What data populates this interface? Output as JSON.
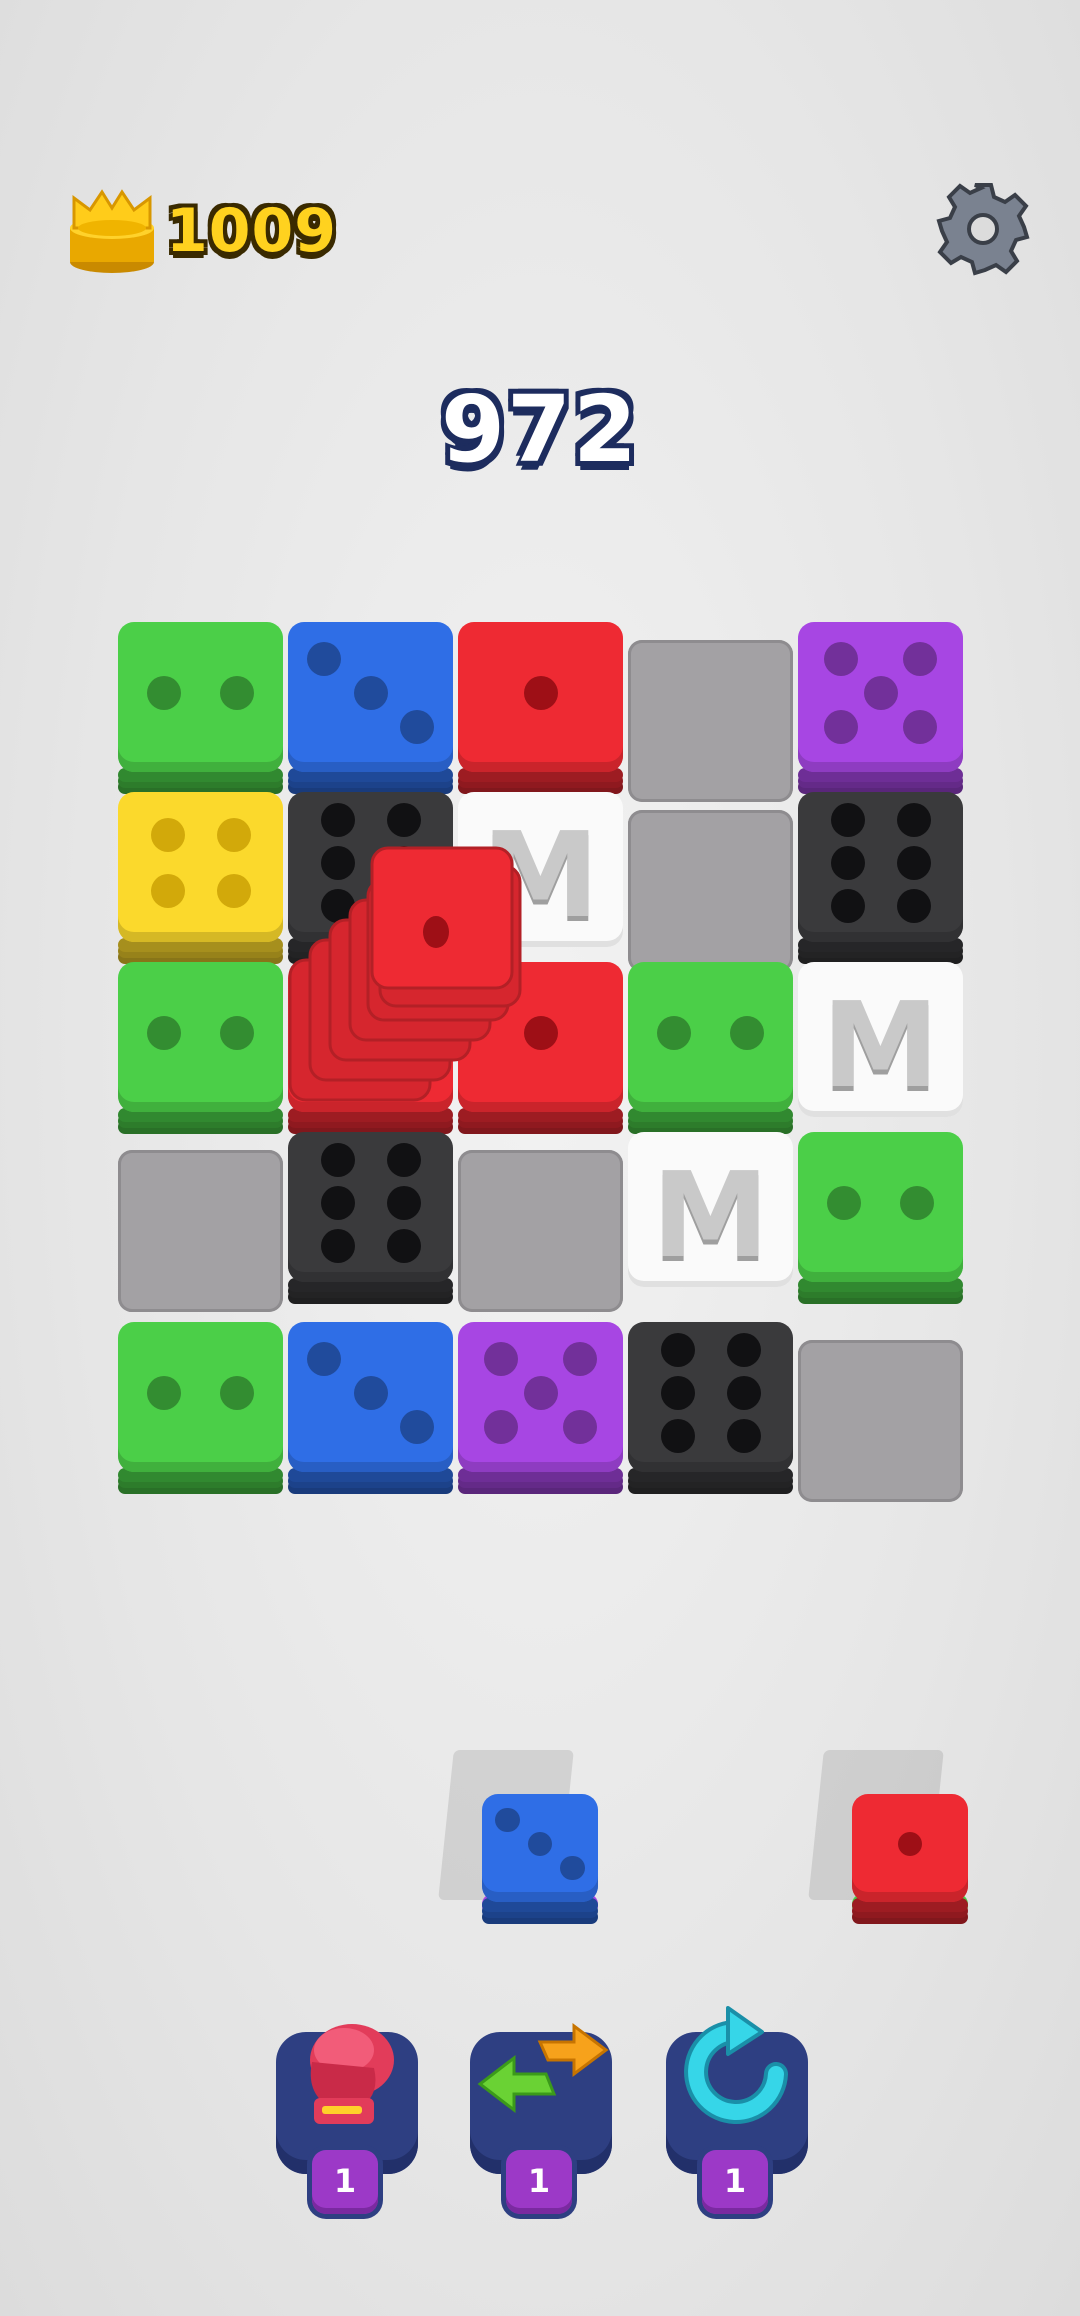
{
  "header": {
    "coins": "1009",
    "coin_icon": "crown-icon",
    "settings_icon": "gear-icon"
  },
  "score": "972",
  "colors": {
    "green": "#4bcf48",
    "blue": "#2f6ee6",
    "red": "#ee2a33",
    "purple": "#a746e3",
    "yellow": "#fbd92c",
    "black": "#3a3a3c",
    "white": "#fafafa",
    "empty": "#a3a1a4"
  },
  "board": {
    "columns": 5,
    "rows": 5,
    "tiles": [
      {
        "row": 0,
        "col": 0,
        "type": "die",
        "color": "green",
        "pips": 2
      },
      {
        "row": 0,
        "col": 1,
        "type": "die",
        "color": "blue",
        "pips": 3
      },
      {
        "row": 0,
        "col": 2,
        "type": "die",
        "color": "red",
        "pips": 1
      },
      {
        "row": 0,
        "col": 3,
        "type": "empty"
      },
      {
        "row": 0,
        "col": 4,
        "type": "die",
        "color": "purple",
        "pips": 5
      },
      {
        "row": 1,
        "col": 0,
        "type": "die",
        "color": "yellow",
        "pips": 4
      },
      {
        "row": 1,
        "col": 1,
        "type": "die",
        "color": "black",
        "pips": 6
      },
      {
        "row": 1,
        "col": 2,
        "type": "m-block",
        "letter": "M"
      },
      {
        "row": 1,
        "col": 3,
        "type": "empty"
      },
      {
        "row": 1,
        "col": 4,
        "type": "die",
        "color": "black",
        "pips": 6
      },
      {
        "row": 2,
        "col": 0,
        "type": "die",
        "color": "green",
        "pips": 2
      },
      {
        "row": 2,
        "col": 1,
        "type": "die",
        "color": "red",
        "pips": 1
      },
      {
        "row": 2,
        "col": 2,
        "type": "die",
        "color": "red",
        "pips": 1
      },
      {
        "row": 2,
        "col": 3,
        "type": "die",
        "color": "green",
        "pips": 2
      },
      {
        "row": 2,
        "col": 4,
        "type": "m-block",
        "letter": "M"
      },
      {
        "row": 3,
        "col": 0,
        "type": "empty"
      },
      {
        "row": 3,
        "col": 1,
        "type": "die",
        "color": "black",
        "pips": 6
      },
      {
        "row": 3,
        "col": 2,
        "type": "empty"
      },
      {
        "row": 3,
        "col": 3,
        "type": "m-block",
        "letter": "M"
      },
      {
        "row": 3,
        "col": 4,
        "type": "die",
        "color": "green",
        "pips": 2
      },
      {
        "row": 4,
        "col": 0,
        "type": "die",
        "color": "green",
        "pips": 2
      },
      {
        "row": 4,
        "col": 1,
        "type": "die",
        "color": "blue",
        "pips": 3
      },
      {
        "row": 4,
        "col": 2,
        "type": "die",
        "color": "purple",
        "pips": 5
      },
      {
        "row": 4,
        "col": 3,
        "type": "die",
        "color": "black",
        "pips": 6
      },
      {
        "row": 4,
        "col": 4,
        "type": "empty"
      }
    ],
    "moving_stack": {
      "color": "red",
      "pips": 1
    }
  },
  "tray": [
    {
      "color": "blue",
      "pips": 3,
      "under": "purple"
    },
    {
      "color": "red",
      "pips": 1,
      "under": "green"
    }
  ],
  "boosters": [
    {
      "name": "boxing-glove-icon",
      "count": "1"
    },
    {
      "name": "swap-arrows-icon",
      "count": "1"
    },
    {
      "name": "refresh-icon",
      "count": "1"
    }
  ]
}
